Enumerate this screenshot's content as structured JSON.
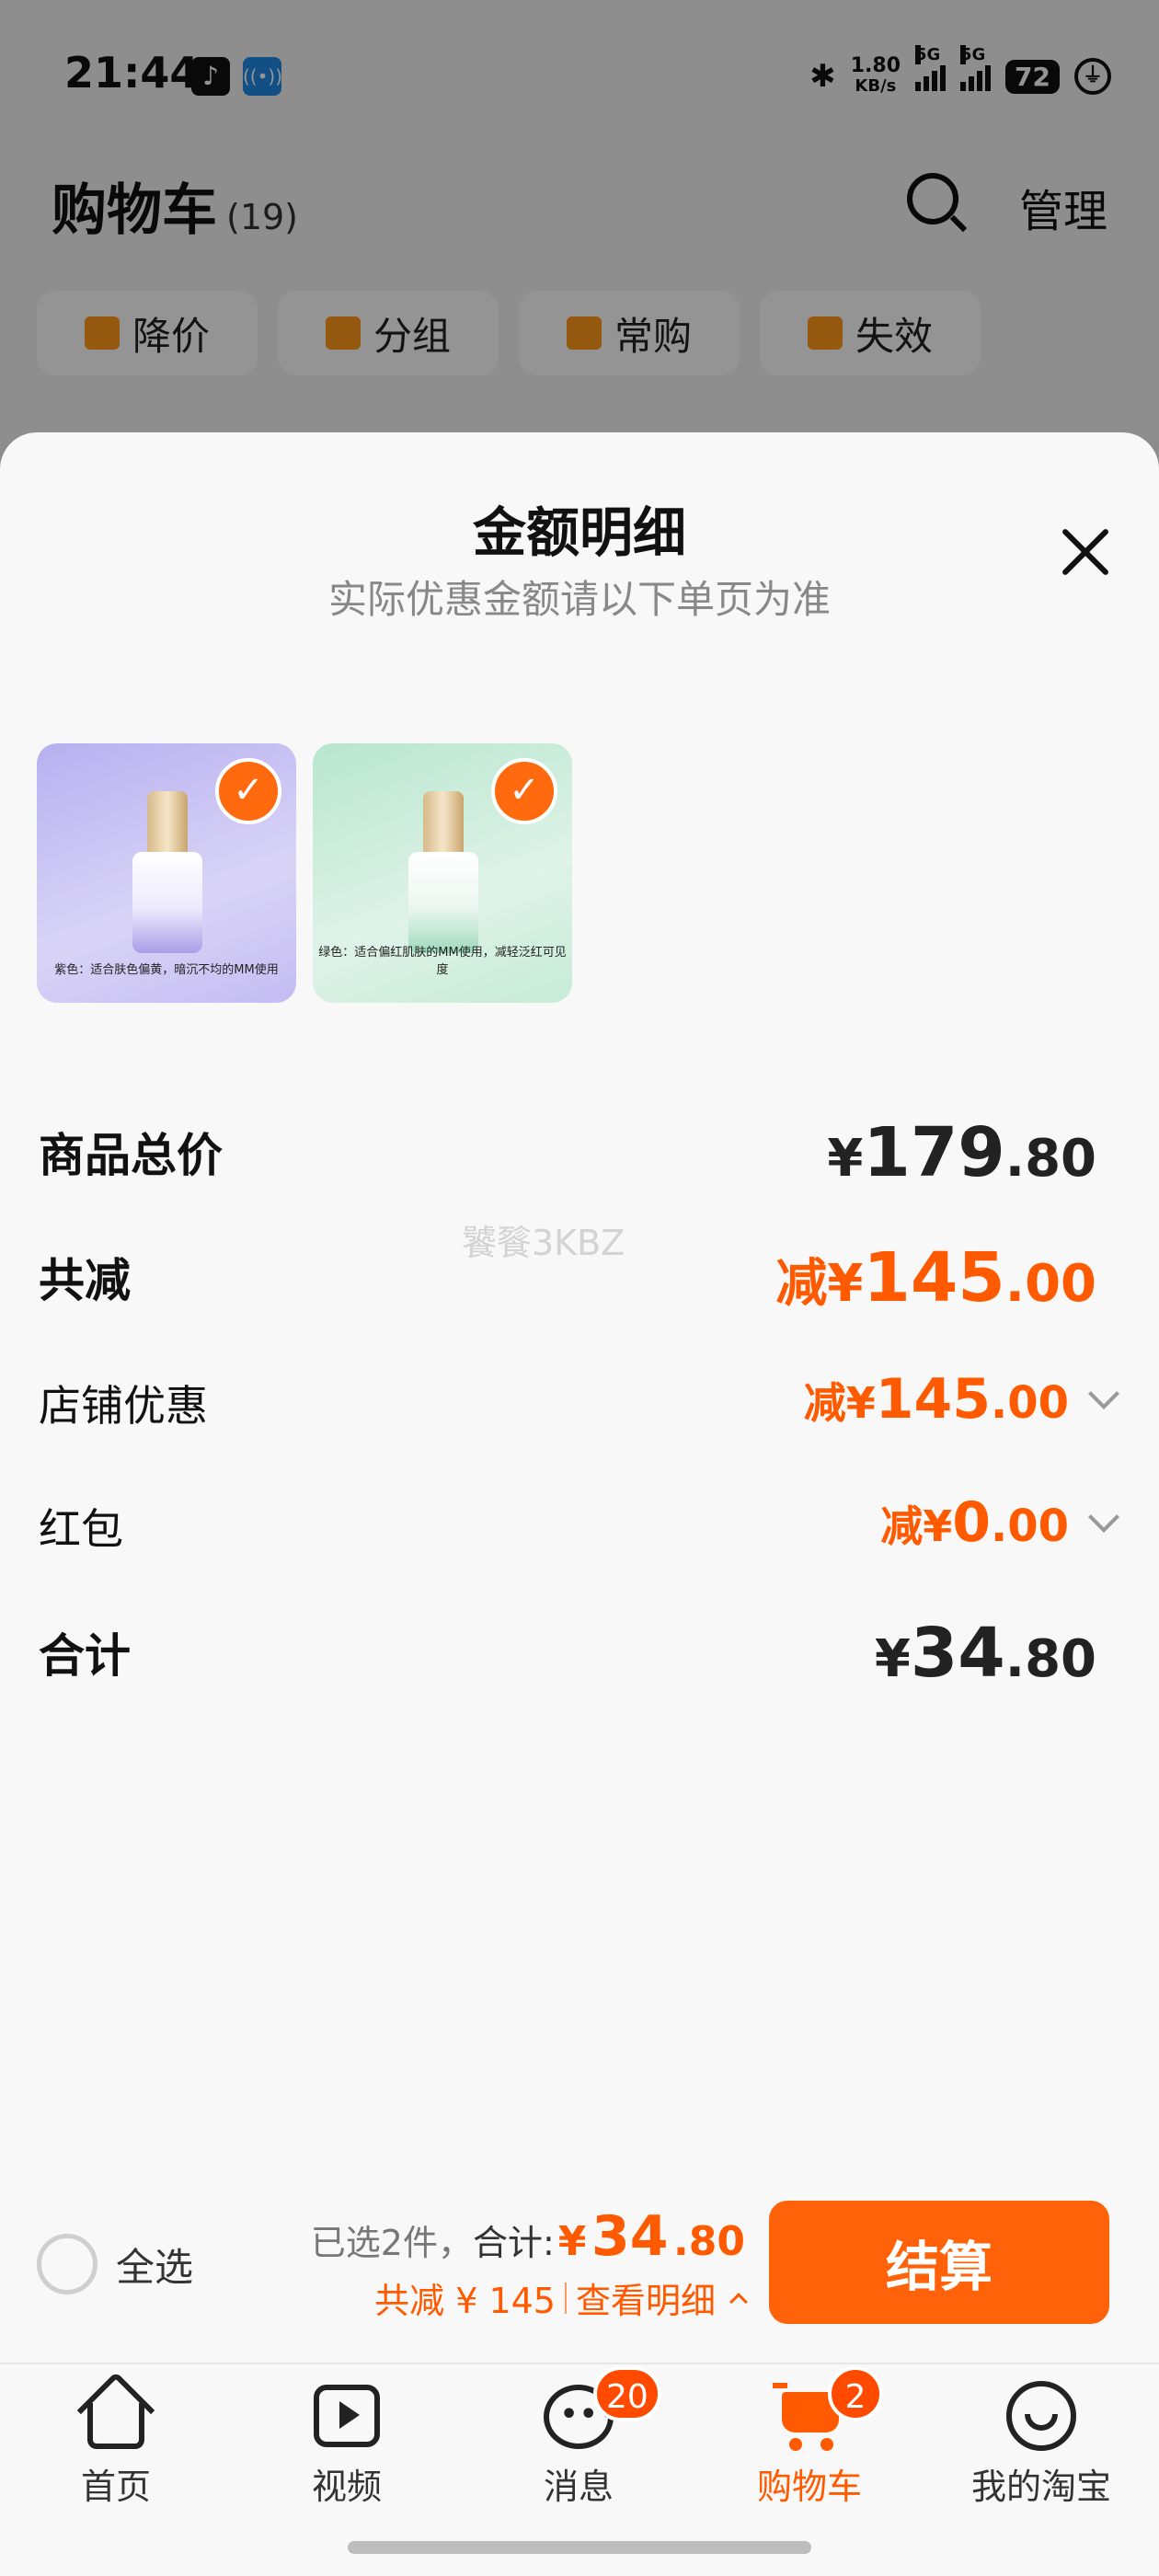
{
  "status_bar": {
    "time": "21:44",
    "net_speed_value": "1.80",
    "net_speed_unit": "KB/s",
    "signal1_label": "5G",
    "signal2_label": "5G",
    "battery": "72",
    "icons": [
      "tiktok-icon",
      "radio-icon",
      "bluetooth-icon",
      "signal-icon",
      "signal-icon",
      "battery-icon",
      "charging-icon"
    ]
  },
  "cart": {
    "title": "购物车",
    "count": "(19)",
    "manage_label": "管理",
    "chips": [
      {
        "label": "降价",
        "icon": "price-drop-icon"
      },
      {
        "label": "分组",
        "icon": "folder-icon"
      },
      {
        "label": "常购",
        "icon": "cart-plus-icon"
      },
      {
        "label": "失效",
        "icon": "expired-tag-icon"
      }
    ]
  },
  "sheet": {
    "title": "金额明细",
    "subtitle": "实际优惠金额请以下单页为准",
    "products": [
      {
        "caption": "紫色：适合肤色偏黄，暗沉不均的MM使用",
        "color": "purple",
        "checked": true
      },
      {
        "caption": "绿色：适合偏红肌肤的MM使用，减轻泛红可见度",
        "color": "green",
        "checked": true
      }
    ],
    "rows": {
      "subtotal": {
        "label": "商品总价",
        "yuan": "¥",
        "int": "179",
        "dec": ".80"
      },
      "total_discount": {
        "label": "共减",
        "prefix": "减¥",
        "int": "145",
        "dec": ".00"
      },
      "shop_discount": {
        "label": "店铺优惠",
        "prefix": "减¥",
        "int": "145",
        "dec": ".00"
      },
      "red_packet": {
        "label": "红包",
        "prefix": "减¥",
        "int": "0",
        "dec": ".00"
      },
      "total": {
        "label": "合计",
        "yuan": "¥",
        "int": "34",
        "dec": ".80"
      }
    },
    "watermark": "饕餮3KBZ"
  },
  "action_bar": {
    "select_all_label": "全选",
    "selected_count": "已选2件，",
    "total_label": "合计:",
    "total_yuan": "¥",
    "total_int": "34",
    "total_dec": ".80",
    "discount_text": "共减 ¥ 145",
    "view_detail": "查看明细",
    "checkout_label": "结算"
  },
  "tab_bar": {
    "tabs": [
      {
        "label": "首页",
        "icon": "home-icon"
      },
      {
        "label": "视频",
        "icon": "video-icon"
      },
      {
        "label": "消息",
        "icon": "message-icon",
        "badge": "20"
      },
      {
        "label": "购物车",
        "icon": "cart-icon",
        "badge": "2",
        "active": true
      },
      {
        "label": "我的淘宝",
        "icon": "profile-icon"
      }
    ]
  },
  "colors": {
    "accent": "#ff5a00",
    "checkout_button": "#ff6208",
    "overlay": "rgba(0,0,0,0.42)"
  }
}
